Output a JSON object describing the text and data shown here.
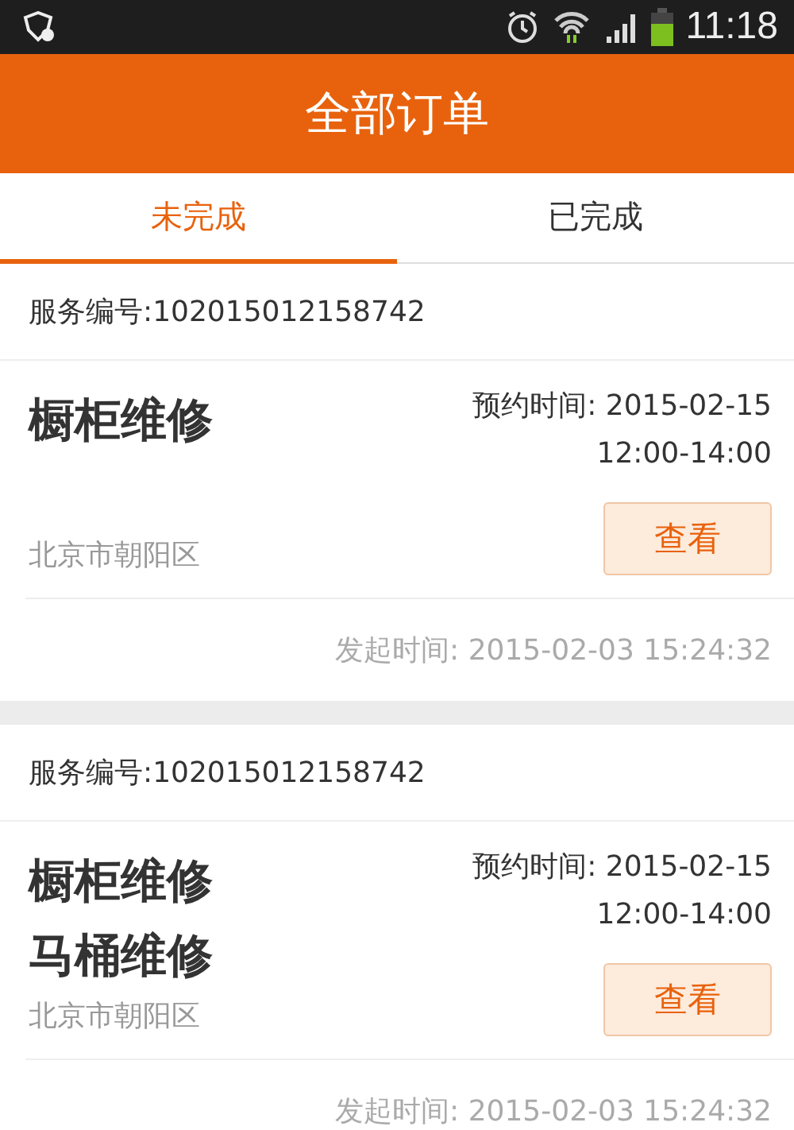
{
  "status_bar": {
    "time": "11:18"
  },
  "title": "全部订单",
  "tabs": [
    {
      "label": "未完成",
      "selected": true
    },
    {
      "label": "已完成",
      "selected": false
    }
  ],
  "orders": [
    {
      "service_no": "服务编号:102015012158742",
      "items": [
        "橱柜维修"
      ],
      "appointment": "预约时间: 2015-02-15",
      "appointment_time": "12:00-14:00",
      "address": "北京市朝阳区",
      "button": "查看",
      "created": "发起时间: 2015-02-03 15:24:32"
    },
    {
      "service_no": "服务编号:102015012158742",
      "items": [
        "橱柜维修",
        "马桶维修"
      ],
      "appointment": "预约时间: 2015-02-15",
      "appointment_time": "12:00-14:00",
      "address": "北京市朝阳区",
      "button": "查看",
      "created": "发起时间: 2015-02-03 15:24:32"
    }
  ]
}
